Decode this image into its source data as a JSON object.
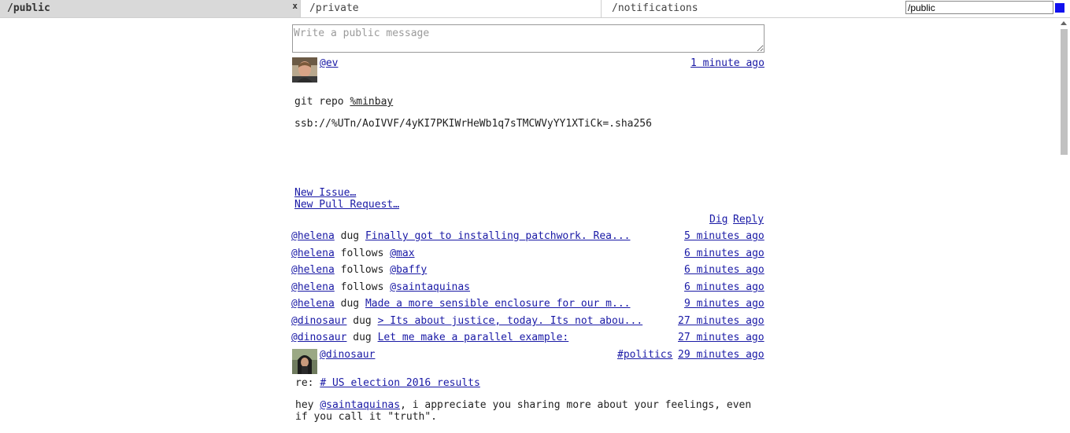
{
  "tabs": {
    "public": "/public",
    "close": "x",
    "private": "/private",
    "notifications": "/notifications"
  },
  "address": {
    "value": "/public"
  },
  "compose": {
    "placeholder": "Write a public message"
  },
  "post1": {
    "author": "@ev",
    "time": "1 minute ago",
    "prefix": "git repo ",
    "repo_link": "%minbay",
    "ssb": "ssb://%UTn/AoIVVF/4yKI7PKIWrHeWb1q7sTMCWVyYY1XTiCk=.sha256",
    "new_issue": "New Issue…",
    "new_pr": "New Pull Request…",
    "dig": "Dig",
    "reply": "Reply"
  },
  "activity": [
    {
      "user": "@helena",
      "verb": "dug",
      "target": "Finally got to installing patchwork. Rea...",
      "time": "5 minutes ago"
    },
    {
      "user": "@helena",
      "verb": "follows",
      "target": "@max",
      "time": "6 minutes ago"
    },
    {
      "user": "@helena",
      "verb": "follows",
      "target": "@baffy",
      "time": "6 minutes ago"
    },
    {
      "user": "@helena",
      "verb": "follows",
      "target": "@saintaquinas",
      "time": "6 minutes ago"
    },
    {
      "user": "@helena",
      "verb": "dug",
      "target": "Made a more sensible enclosure for our m...",
      "time": "9 minutes ago"
    },
    {
      "user": "@dinosaur",
      "verb": "dug",
      "target": "> Its about justice, today. Its not abou...",
      "time": "27 minutes ago"
    },
    {
      "user": "@dinosaur",
      "verb": "dug",
      "target": "Let me make a parallel example:",
      "time": "27 minutes ago"
    }
  ],
  "post2": {
    "author": "@dinosaur",
    "channel": "#politics",
    "time": "29 minutes ago",
    "re_prefix": "re: ",
    "re_link": "# US election 2016 results",
    "body_prefix": "hey ",
    "mention": "@saintaquinas",
    "body_rest": ", i appreciate you sharing more about your feelings, even",
    "body_line2": "if you call it \"truth\"."
  }
}
